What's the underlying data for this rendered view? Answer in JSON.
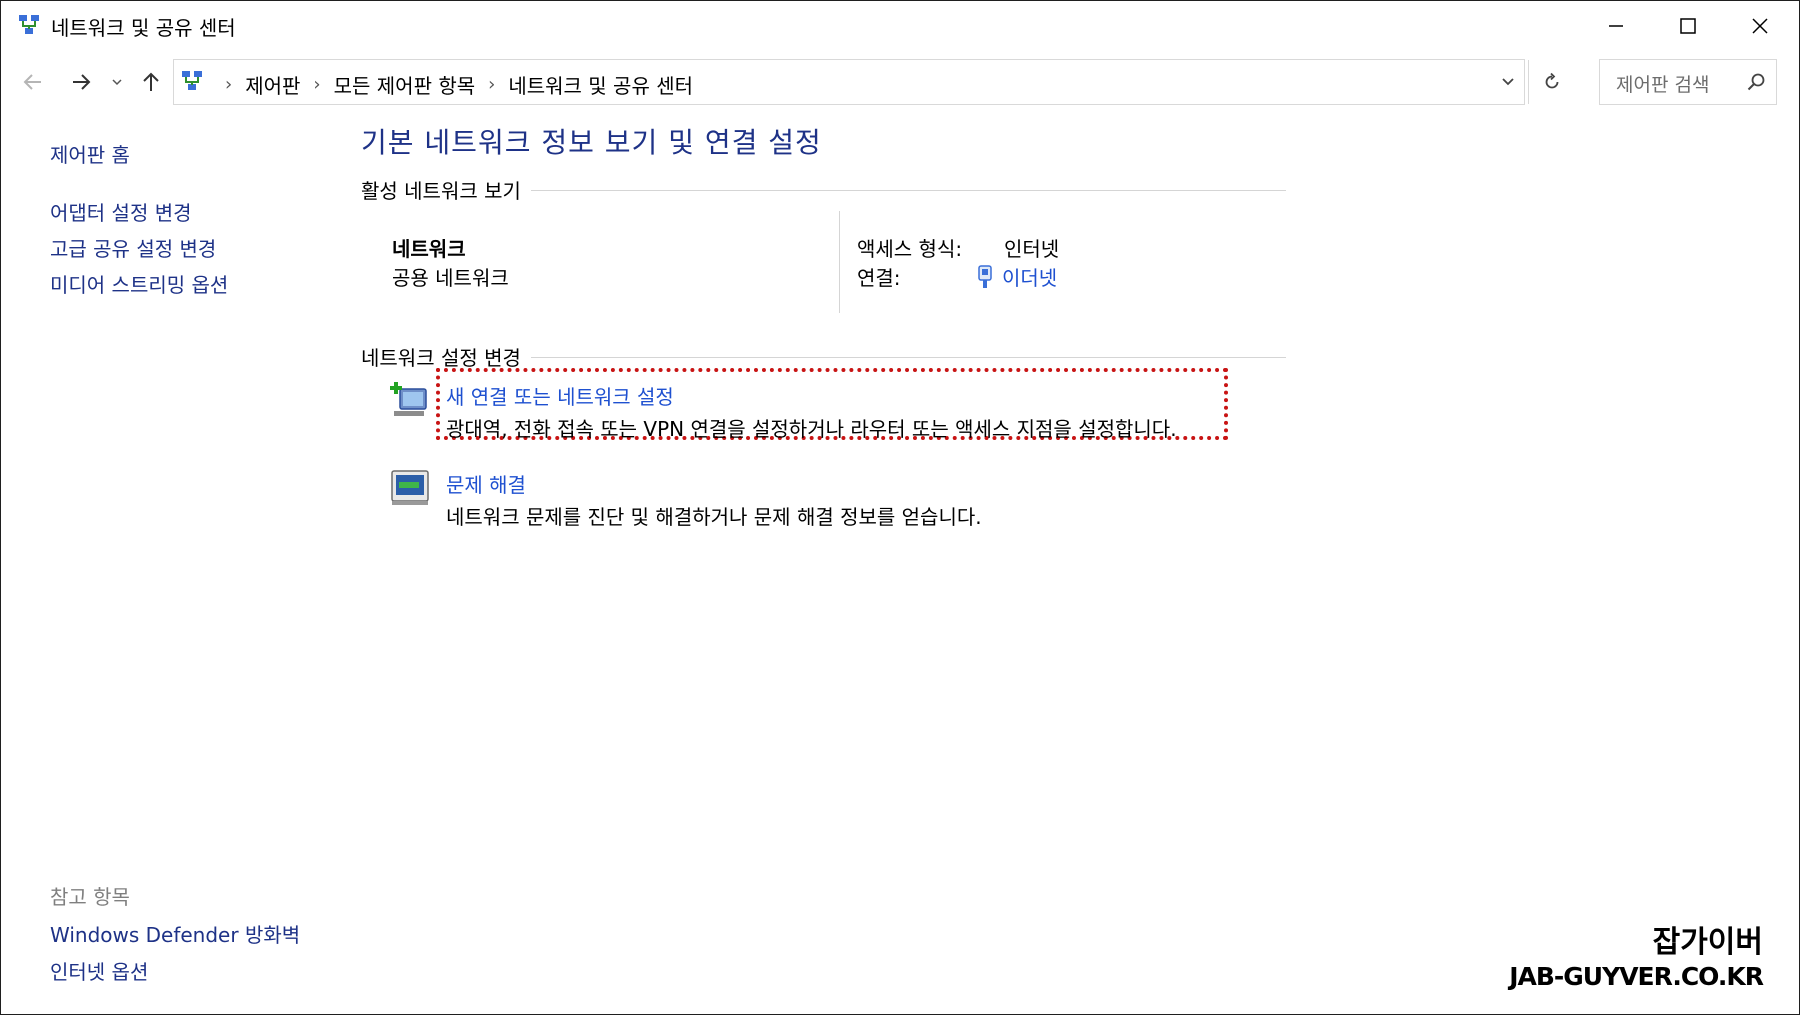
{
  "window": {
    "title": "네트워크 및 공유 센터"
  },
  "navbar": {
    "breadcrumbs": [
      "제어판",
      "모든 제어판 항목",
      "네트워크 및 공유 센터"
    ],
    "separator": "›",
    "search_placeholder": "제어판 검색"
  },
  "sidebar": {
    "home": "제어판 홈",
    "links": [
      "어댑터 설정 변경",
      "고급 공유 설정 변경",
      "미디어 스트리밍 옵션"
    ],
    "see_also_heading": "참고 항목",
    "see_also": [
      "Windows Defender 방화벽",
      "인터넷 옵션"
    ]
  },
  "main": {
    "title": "기본 네트워크 정보 보기 및 연결 설정",
    "active_heading": "활성 네트워크 보기",
    "network": {
      "name": "네트워크",
      "type": "공용 네트워크",
      "access_label": "액세스 형식:",
      "access_value": "인터넷",
      "connection_label": "연결:",
      "connection_value": "이더넷"
    },
    "change_heading": "네트워크 설정 변경",
    "tasks": [
      {
        "icon": "new-connection-icon",
        "link": "새 연결 또는 네트워크 설정",
        "desc": "광대역, 전화 접속 또는 VPN 연결을 설정하거나 라우터 또는 액세스 지점을 설정합니다."
      },
      {
        "icon": "troubleshoot-icon",
        "link": "문제 해결",
        "desc": "네트워크 문제를 진단 및 해결하거나 문제 해결 정보를 얻습니다."
      }
    ]
  },
  "watermark": {
    "line1": "잡가이버",
    "line2": "JAB-GUYVER.CO.KR"
  },
  "colors": {
    "link": "#1e50d0",
    "heading": "#1e3287",
    "highlight": "#c81414"
  }
}
